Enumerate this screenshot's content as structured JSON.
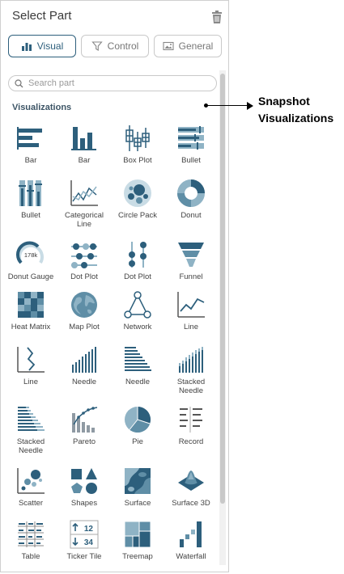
{
  "header": {
    "title": "Select Part",
    "delete_icon": "trash-icon"
  },
  "tabs": [
    {
      "label": "Visual",
      "icon": "bar-chart-icon",
      "active": true
    },
    {
      "label": "Control",
      "icon": "filter-icon",
      "active": false
    },
    {
      "label": "General",
      "icon": "image-icon",
      "active": false
    }
  ],
  "search": {
    "placeholder": "Search part"
  },
  "section": {
    "title": "Visualizations"
  },
  "annotation": {
    "line1": "Snapshot",
    "line2": "Visualizations"
  },
  "colors": {
    "accent": "#2d5f7c",
    "light": "#8fb3c5",
    "mid": "#5f8ea6"
  },
  "parts": [
    {
      "label": "Bar",
      "icon": "bar-horizontal-icon"
    },
    {
      "label": "Bar",
      "icon": "bar-vertical-icon"
    },
    {
      "label": "Box Plot",
      "icon": "box-plot-icon"
    },
    {
      "label": "Bullet",
      "icon": "bullet-horizontal-icon"
    },
    {
      "label": "Bullet",
      "icon": "bullet-vertical-icon"
    },
    {
      "label": "Categorical Line",
      "icon": "categorical-line-icon"
    },
    {
      "label": "Circle Pack",
      "icon": "circle-pack-icon"
    },
    {
      "label": "Donut",
      "icon": "donut-icon"
    },
    {
      "label": "Donut Gauge",
      "icon": "donut-gauge-icon",
      "value_text": "178k"
    },
    {
      "label": "Dot Plot",
      "icon": "dot-plot-horizontal-icon"
    },
    {
      "label": "Dot Plot",
      "icon": "dot-plot-vertical-icon"
    },
    {
      "label": "Funnel",
      "icon": "funnel-icon"
    },
    {
      "label": "Heat Matrix",
      "icon": "heat-matrix-icon"
    },
    {
      "label": "Map Plot",
      "icon": "globe-icon"
    },
    {
      "label": "Network",
      "icon": "network-icon"
    },
    {
      "label": "Line",
      "icon": "line-icon"
    },
    {
      "label": "Line",
      "icon": "line-vertical-icon"
    },
    {
      "label": "Needle",
      "icon": "needle-vertical-icon"
    },
    {
      "label": "Needle",
      "icon": "needle-horizontal-icon"
    },
    {
      "label": "Stacked Needle",
      "icon": "stacked-needle-vertical-icon"
    },
    {
      "label": "Stacked Needle",
      "icon": "stacked-needle-horizontal-icon"
    },
    {
      "label": "Pareto",
      "icon": "pareto-icon"
    },
    {
      "label": "Pie",
      "icon": "pie-icon"
    },
    {
      "label": "Record",
      "icon": "record-icon"
    },
    {
      "label": "Scatter",
      "icon": "scatter-icon"
    },
    {
      "label": "Shapes",
      "icon": "shapes-icon"
    },
    {
      "label": "Surface",
      "icon": "surface-icon"
    },
    {
      "label": "Surface 3D",
      "icon": "surface-3d-icon"
    },
    {
      "label": "Table",
      "icon": "table-icon"
    },
    {
      "label": "Ticker Tile",
      "icon": "ticker-tile-icon",
      "value_text_1": "12",
      "value_text_2": "34"
    },
    {
      "label": "Treemap",
      "icon": "treemap-icon"
    },
    {
      "label": "Waterfall",
      "icon": "waterfall-icon"
    }
  ]
}
